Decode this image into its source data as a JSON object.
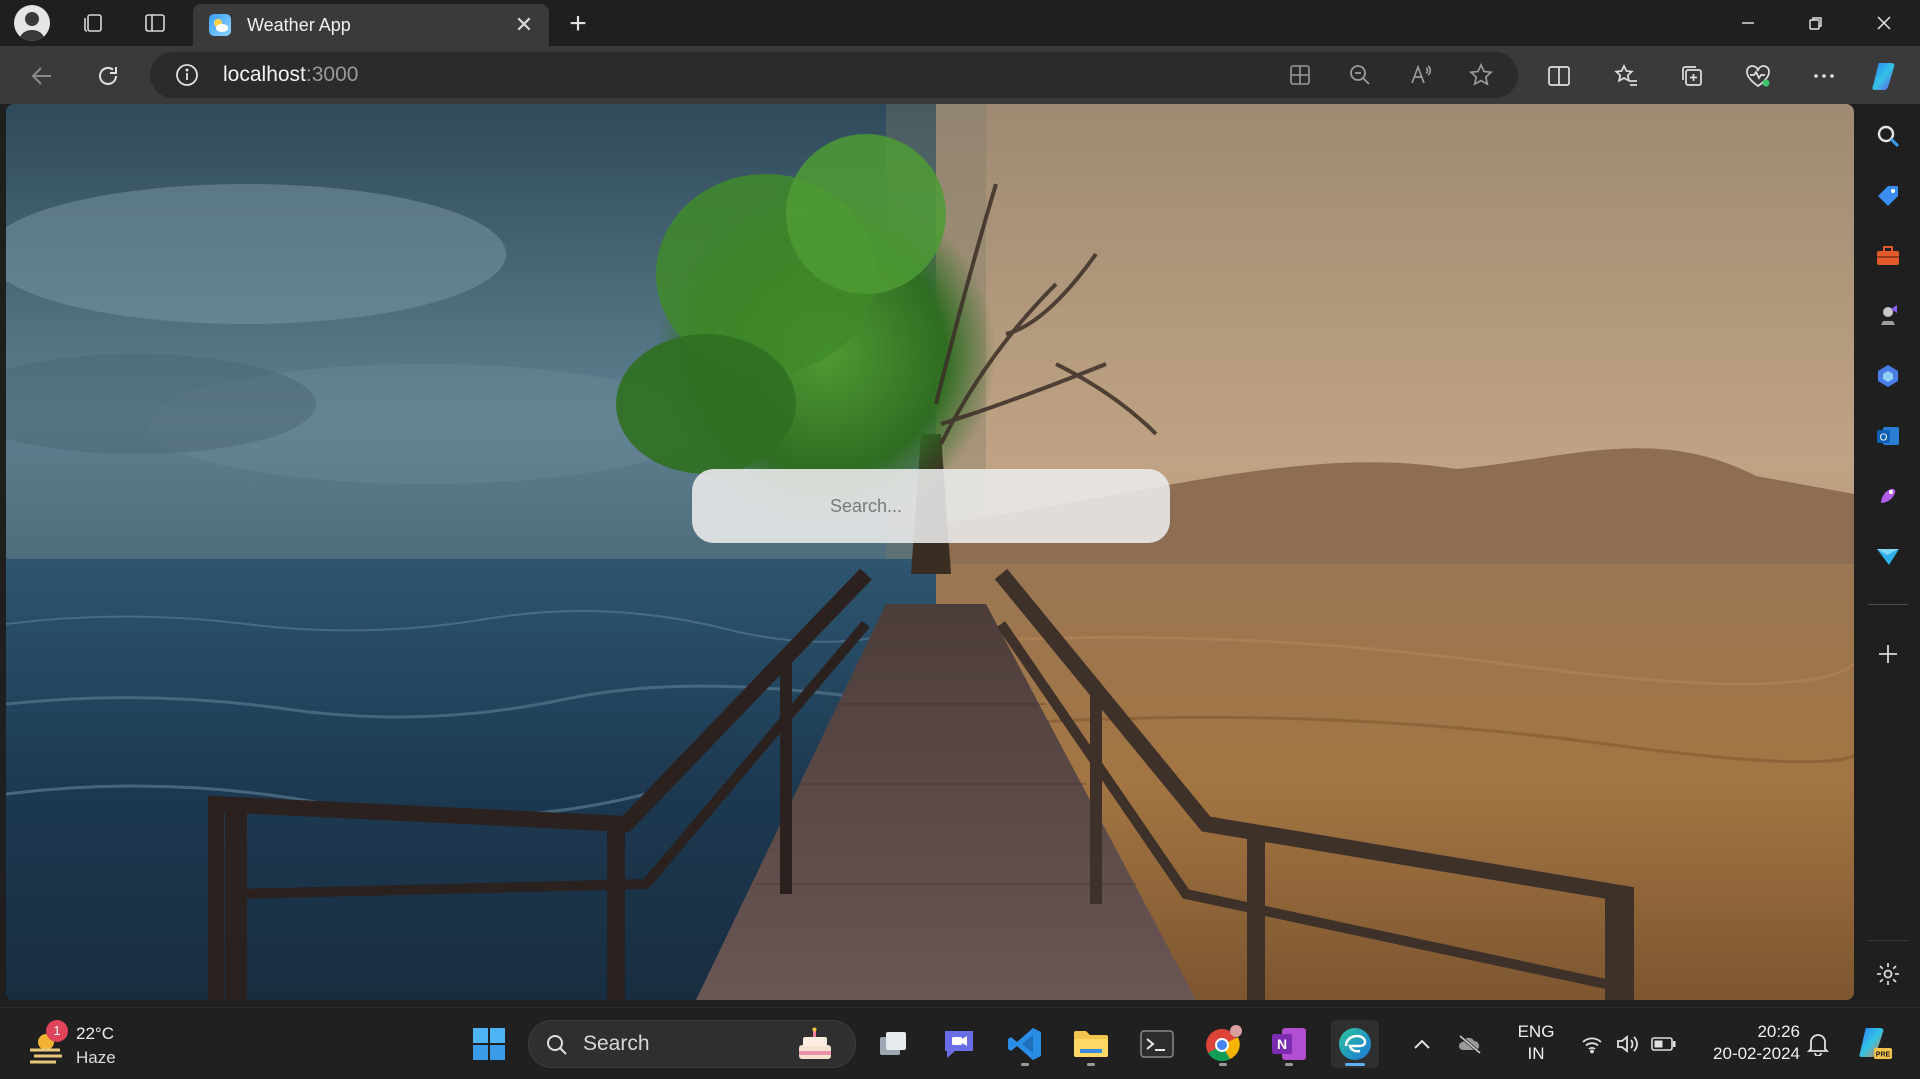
{
  "browser": {
    "tab": {
      "title": "Weather App",
      "close": "✕"
    },
    "new_tab": "+",
    "address": {
      "host": "localhost",
      "port": ":3000"
    }
  },
  "page": {
    "search": {
      "placeholder": "Search..."
    }
  },
  "window_controls": {
    "minimize": "—",
    "restore": "❐",
    "close": "✕"
  },
  "taskbar": {
    "weather": {
      "temperature": "22°C",
      "condition": "Haze",
      "badge": "1"
    },
    "search_label": "Search",
    "language": {
      "line1": "ENG",
      "line2": "IN"
    },
    "clock": {
      "time": "20:26",
      "date": "20-02-2024"
    }
  },
  "colors": {
    "tab_bg": "#3a3a3a",
    "chrome_bg": "#1f1f1f",
    "accent": "#5fb2f2"
  }
}
